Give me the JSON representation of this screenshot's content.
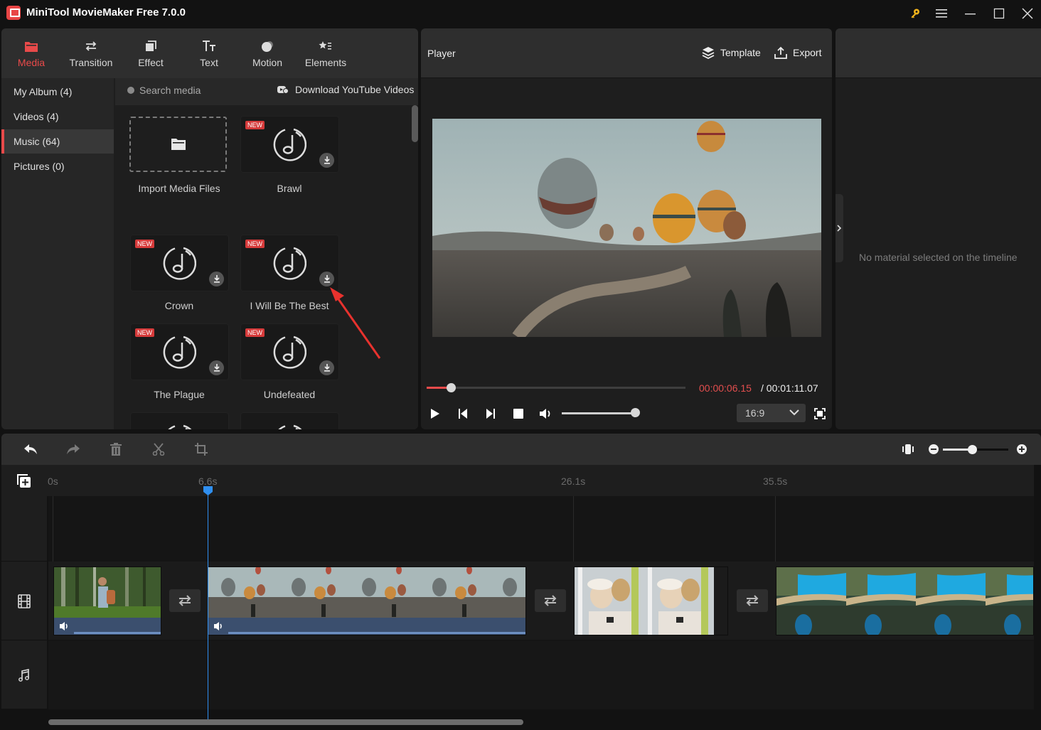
{
  "window": {
    "title": "MiniTool MovieMaker Free 7.0.0",
    "controls": [
      "key",
      "menu",
      "minimize",
      "maximize",
      "close"
    ],
    "key_color": "#f2b31b"
  },
  "media_panel": {
    "tabs": [
      {
        "label": "Media",
        "icon": "folder-icon",
        "active": true
      },
      {
        "label": "Transition",
        "icon": "swap-arrows-icon",
        "active": false
      },
      {
        "label": "Effect",
        "icon": "layers-square-icon",
        "active": false
      },
      {
        "label": "Text",
        "icon": "text-icon",
        "active": false
      },
      {
        "label": "Motion",
        "icon": "motion-icon",
        "active": false
      },
      {
        "label": "Elements",
        "icon": "star-list-icon",
        "active": false
      }
    ],
    "categories": [
      {
        "label": "My Album (4)",
        "active": false
      },
      {
        "label": "Videos (4)",
        "active": false
      },
      {
        "label": "Music (64)",
        "active": true
      },
      {
        "label": "Pictures (0)",
        "active": false
      }
    ],
    "search_placeholder": "Search media",
    "download_youtube_label": "Download YouTube Videos",
    "import_label": "Import Media Files",
    "new_badge": "NEW",
    "items": [
      {
        "label": "Brawl",
        "new": true
      },
      {
        "label": "Crown",
        "new": true
      },
      {
        "label": "I Will Be The Best",
        "new": true
      },
      {
        "label": "The Plague",
        "new": true
      },
      {
        "label": "Undefeated",
        "new": true
      },
      {
        "label": "",
        "new": false
      },
      {
        "label": "",
        "new": false
      }
    ],
    "accent_color": "#e84a4a"
  },
  "player": {
    "title": "Player",
    "template_label": "Template",
    "export_label": "Export",
    "current_time": "00:00:06.15",
    "total_time": "/ 00:01:11.07",
    "progress_fraction": 0.093,
    "volume_fraction": 1.0,
    "aspect_ratio": "16:9"
  },
  "properties": {
    "empty_message": "No material selected on the timeline"
  },
  "timeline": {
    "toolbar": [
      "undo",
      "redo",
      "delete",
      "split",
      "crop"
    ],
    "zoom_fraction": 0.45,
    "ruler_labels": [
      {
        "label": "0s"
      },
      {
        "label": "6.6s"
      },
      {
        "label": "26.1s"
      },
      {
        "label": "35.5s"
      }
    ],
    "playhead_time": "6.6s",
    "clips": [
      {
        "name": "forest-hiker",
        "has_audio": true
      },
      {
        "name": "hot-air-balloons",
        "has_audio": true
      },
      {
        "name": "couple-on-train",
        "has_audio": false
      },
      {
        "name": "coastal-cliffs",
        "has_audio": false
      }
    ],
    "playhead_color": "#2f8ff0"
  }
}
